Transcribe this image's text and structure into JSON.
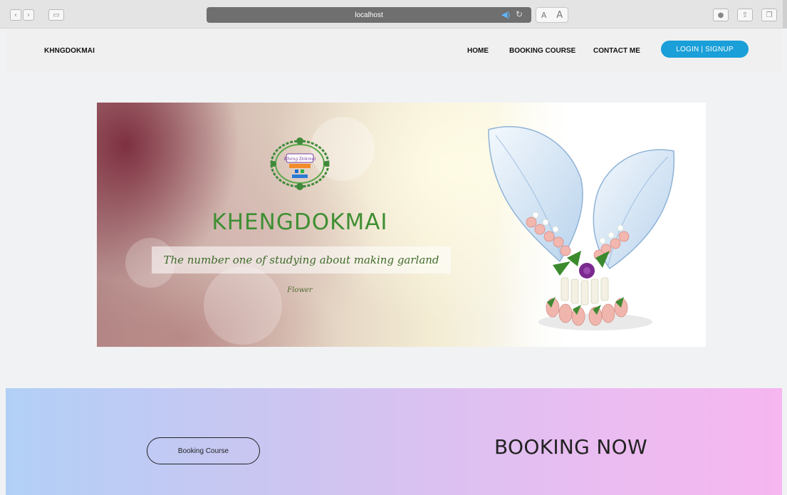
{
  "browser": {
    "address": "localhost",
    "back_icon": "chevron-left-icon",
    "forward_icon": "chevron-right-icon",
    "text_size_small": "A",
    "text_size_large": "A"
  },
  "navbar": {
    "brand": "KHNGDOKMAI",
    "items": [
      "HOME",
      "BOOKING COURSE",
      "CONTACT ME"
    ],
    "login": "LOGIN | SIGNUP",
    "accent_color": "#1a9fd8"
  },
  "hero": {
    "title": "KHENGDOKMAI",
    "tagline": "The number one of studying about making garland",
    "subtag": "Flower",
    "logo_text": "Kheng Dokmai",
    "title_color": "#3f8f33"
  },
  "band": {
    "button": "Booking Course",
    "heading": "BOOKING NOW"
  }
}
